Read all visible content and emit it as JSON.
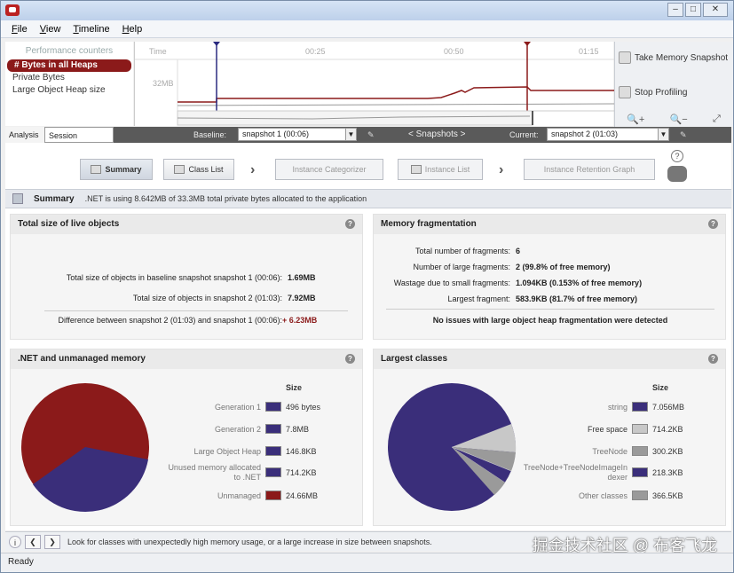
{
  "window": {
    "title": ""
  },
  "menu": [
    "File",
    "View",
    "Timeline",
    "Help"
  ],
  "counters": {
    "header": "Performance counters",
    "items": [
      "# Bytes in all Heaps",
      "Private Bytes",
      "Large Object Heap size"
    ],
    "selected_index": 0
  },
  "timeline": {
    "axis_label": "Time",
    "ticks": [
      "00:25",
      "00:50",
      "01:15"
    ],
    "y_label": "32MB"
  },
  "actions": {
    "take_snapshot": "Take Memory Snapshot",
    "stop_profiling": "Stop Profiling"
  },
  "tabs": {
    "analysis": "Analysis",
    "session_overview": "Session Overview"
  },
  "snapshots": {
    "baseline_label": "Baseline:",
    "baseline_value": "snapshot 1 (00:06)",
    "title": "< Snapshots >",
    "current_label": "Current:",
    "current_value": "snapshot 2 (01:03)"
  },
  "nav": {
    "summary": "Summary",
    "class_list": "Class List",
    "instance_categorizer": "Instance Categorizer",
    "instance_list": "Instance List",
    "instance_retention_graph": "Instance Retention Graph"
  },
  "summary_bar": {
    "title": "Summary",
    "message": ".NET is using 8.642MB of 33.3MB total private bytes allocated to the application"
  },
  "live_objects": {
    "title": "Total size of live objects",
    "rows": [
      {
        "label": "Total size of objects in baseline snapshot snapshot 1 (00:06):",
        "value": "1.69MB"
      },
      {
        "label": "Total size of objects in snapshot 2 (01:03):",
        "value": "7.92MB"
      },
      {
        "label": "Difference between snapshot 2 (01:03) and snapshot 1 (00:06):",
        "value": "+ 6.23MB"
      }
    ]
  },
  "fragmentation": {
    "title": "Memory fragmentation",
    "rows": [
      {
        "label": "Total number of fragments:",
        "value": "6"
      },
      {
        "label": "Number of large fragments:",
        "value": "2 (99.8% of free memory)"
      },
      {
        "label": "Wastage due to small fragments:",
        "value": "1.094KB (0.153% of free memory)"
      },
      {
        "label": "Largest fragment:",
        "value": "583.9KB (81.7% of free memory)"
      }
    ],
    "status": "No issues with large object heap fragmentation were detected"
  },
  "net_memory": {
    "title": ".NET and unmanaged memory",
    "size_header": "Size",
    "rows": [
      {
        "label": "Generation 1",
        "value": "496 bytes",
        "color": "#3a2e7a"
      },
      {
        "label": "Generation 2",
        "value": "7.8MB",
        "color": "#3a2e7a"
      },
      {
        "label": "Large Object Heap",
        "value": "146.8KB",
        "color": "#3a2e7a"
      },
      {
        "label": "Unused memory allocated to .NET",
        "value": "714.2KB",
        "color": "#3a2e7a"
      },
      {
        "label": "Unmanaged",
        "value": "24.66MB",
        "color": "#8b1a1a"
      }
    ]
  },
  "largest_classes": {
    "title": "Largest classes",
    "size_header": "Size",
    "rows": [
      {
        "label": "string",
        "value": "7.056MB",
        "color": "#3a2e7a"
      },
      {
        "label": "Free space",
        "value": "714.2KB",
        "color": "#c8c8c8"
      },
      {
        "label": "TreeNode",
        "value": "300.2KB",
        "color": "#9a9a9a"
      },
      {
        "label": "TreeNode+TreeNodeImageIndexer",
        "value": "218.3KB",
        "color": "#3a2e7a"
      },
      {
        "label": "Other classes",
        "value": "366.5KB",
        "color": "#9a9a9a"
      }
    ]
  },
  "footer": {
    "tip": "Look for classes with unexpectedly high memory usage, or a large increase in size between snapshots.",
    "watermark": "掘金技术社区 @ 布客飞龙"
  },
  "status": "Ready"
}
